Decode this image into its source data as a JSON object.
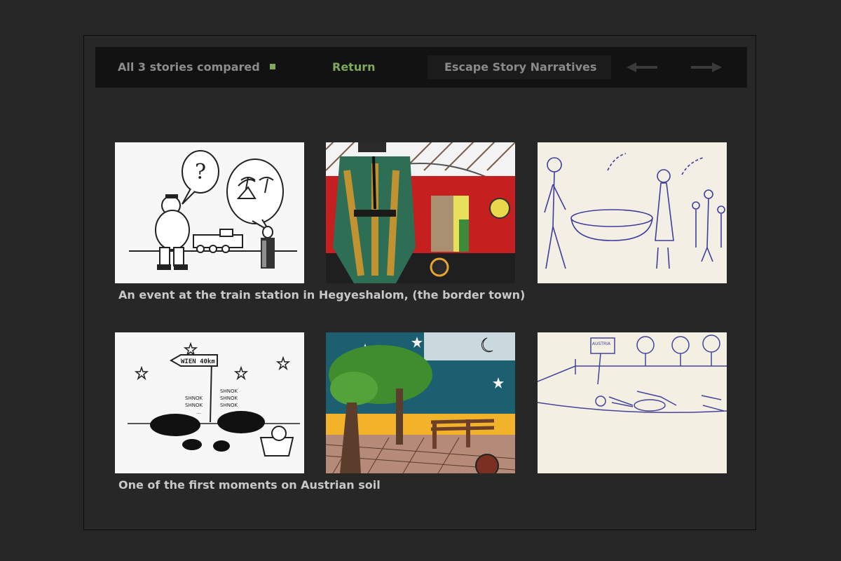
{
  "nav": {
    "compare_label": "All 3 stories compared",
    "return_label": "Return",
    "title": "Escape Story Narratives",
    "prev_icon": "arrow-left-icon",
    "next_icon": "arrow-right-icon"
  },
  "rows": [
    {
      "caption": "An event at the train station in Hegyeshalom, (the border town)",
      "thumbnails": [
        "story-1-drawing",
        "story-2-drawing",
        "story-3-drawing"
      ]
    },
    {
      "caption": "One of the first moments on Austrian soil",
      "thumbnails": [
        "story-1-drawing",
        "story-2-drawing",
        "story-3-drawing"
      ]
    }
  ],
  "row2_drawing_text": {
    "signpost": "WIEN 40km",
    "left_snores": [
      "SHNOK",
      "SHNOK",
      "..."
    ],
    "right_snores": [
      "SHNOK",
      "SHNOK",
      "SHNOK"
    ],
    "sign3": "AUSTRIA"
  },
  "colors": {
    "accent": "#7fa85a",
    "background": "#262626",
    "navbar": "#121212",
    "caption": "#c8c8c8"
  }
}
